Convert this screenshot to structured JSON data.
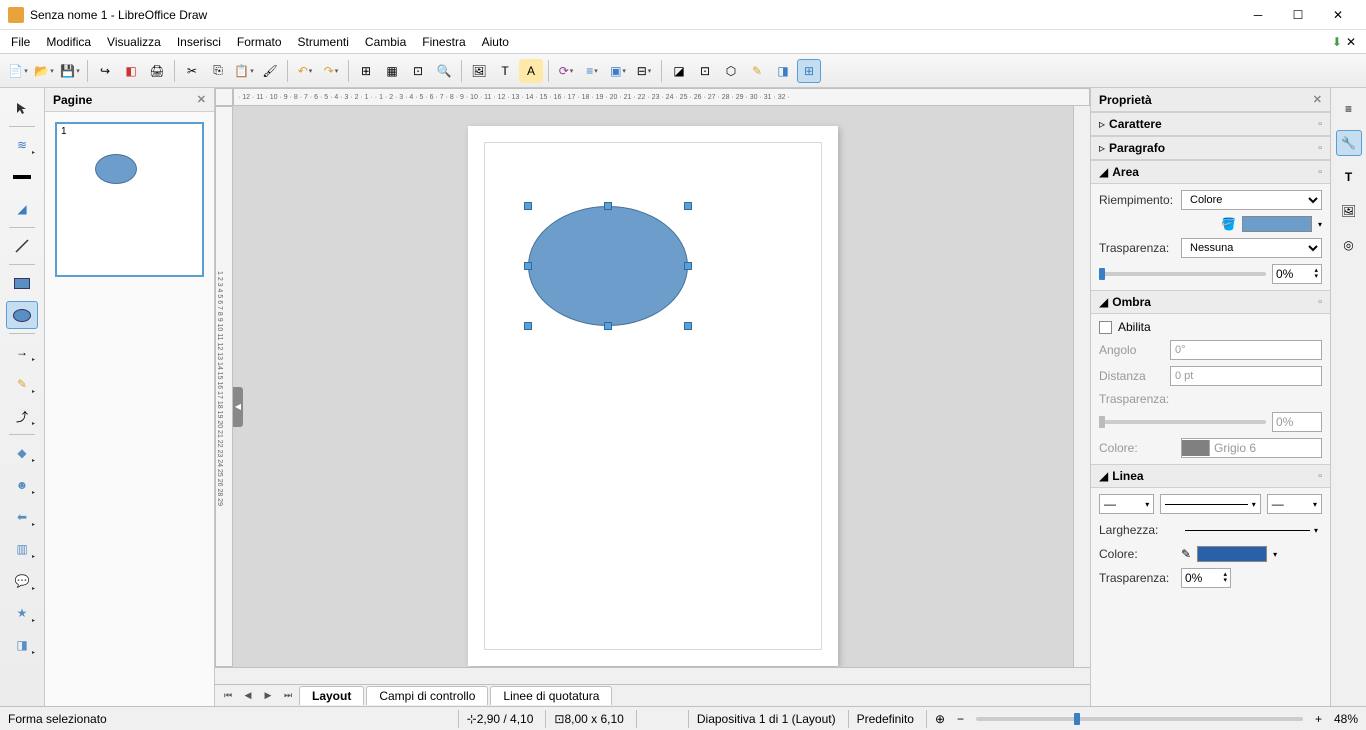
{
  "window": {
    "title": "Senza nome 1 - LibreOffice Draw"
  },
  "menu": {
    "items": [
      "File",
      "Modifica",
      "Visualizza",
      "Inserisci",
      "Formato",
      "Strumenti",
      "Cambia",
      "Finestra",
      "Aiuto"
    ]
  },
  "pages_panel": {
    "title": "Pagine",
    "page_number": "1"
  },
  "canvas": {
    "tabs": [
      "Layout",
      "Campi di controllo",
      "Linee di quotatura"
    ],
    "ruler_h": "· 12 · 11 · 10 · 9 · 8 · 7 · 6 · 5 · 4 · 3 · 2 · 1 ·   · 1 · 2 · 3 · 4 · 5 · 6 · 7 · 8 · 9 · 10 · 11 · 12 · 13 · 14 · 15 · 16 · 17 · 18 · 19 · 20 · 21 · 22 · 23 · 24 · 25 · 26 · 27 · 28 · 29 · 30 · 31 · 32 ·",
    "ruler_v": "1 2 3 4 5 6 7 8 9 10 11 12 13 14 15 16 17 18 19 20 21 22 23 24 25 26 28 29"
  },
  "props": {
    "title": "Proprietà",
    "sections": {
      "carattere": "Carattere",
      "paragrafo": "Paragrafo",
      "area": "Area",
      "ombra": "Ombra",
      "linea": "Linea"
    },
    "area": {
      "fill_label": "Riempimento:",
      "fill_value": "Colore",
      "trasp_label": "Trasparenza:",
      "trasp_value": "Nessuna",
      "trasp_pct": "0%"
    },
    "ombra": {
      "abilita": "Abilita",
      "angolo_label": "Angolo",
      "angolo_value": "0°",
      "distanza_label": "Distanza",
      "distanza_value": "0 pt",
      "trasp_label": "Trasparenza:",
      "trasp_pct": "0%",
      "colore_label": "Colore:",
      "colore_value": "Grigio 6"
    },
    "linea": {
      "largh_label": "Larghezza:",
      "colore_label": "Colore:",
      "trasp_label": "Trasparenza:",
      "trasp_pct": "0%"
    }
  },
  "status": {
    "left": "Forma selezionato",
    "pos": "2,90 / 4,10",
    "size": "8,00 x 6,10",
    "slide": "Diapositiva 1 di 1 (Layout)",
    "preset": "Predefinito",
    "zoom": "48%"
  },
  "colors": {
    "shape_fill": "#6d9ecb",
    "shape_stroke": "#47719a",
    "ombra": "#808080",
    "linea": "#2960a8"
  }
}
